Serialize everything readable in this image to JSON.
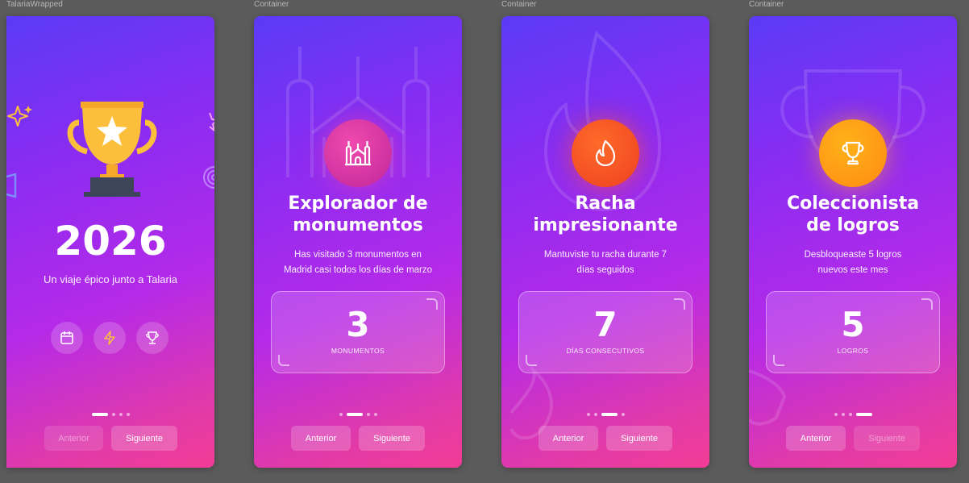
{
  "frames": [
    {
      "label": "TalariaWrapped"
    },
    {
      "label": "Container"
    },
    {
      "label": "Container"
    },
    {
      "label": "Container"
    }
  ],
  "intro": {
    "year": "2026",
    "subtitle": "Un viaje épico junto a Talaria",
    "icons": [
      "calendar-icon",
      "lightning-icon",
      "trophy-icon"
    ],
    "prev_label": "Anterior",
    "next_label": "Siguiente",
    "active_dot": 0
  },
  "slides": [
    {
      "title_line1": "Explorador de",
      "title_line2": "monumentos",
      "desc_line1": "Has visitado 3 monumentos en",
      "desc_line2": "Madrid casi todos los días de marzo",
      "stat_value": "3",
      "stat_label": "MONUMENTOS",
      "icon": "monument-icon",
      "active_dot": 1,
      "prev_label": "Anterior",
      "next_label": "Siguiente"
    },
    {
      "title_line1": "Racha",
      "title_line2": "impresionante",
      "desc_line1": "Mantuviste tu racha durante 7",
      "desc_line2": "días seguidos",
      "stat_value": "7",
      "stat_label": "DÍAS CONSECUTIVOS",
      "icon": "flame-icon",
      "active_dot": 2,
      "prev_label": "Anterior",
      "next_label": "Siguiente"
    },
    {
      "title_line1": "Coleccionista",
      "title_line2": "de logros",
      "desc_line1": "Desbloqueaste 5 logros",
      "desc_line2": "nuevos este mes",
      "stat_value": "5",
      "stat_label": "LOGROS",
      "icon": "trophy-icon",
      "active_dot": 3,
      "prev_label": "Anterior",
      "next_label": "Siguiente"
    }
  ],
  "colors": {
    "gradient_start": "#5a3bf5",
    "gradient_end": "#f23c96",
    "trophy_gold": "#fbbf3c",
    "flame_orange": "#ff5a1f",
    "badge_pink": "#e6359c"
  }
}
